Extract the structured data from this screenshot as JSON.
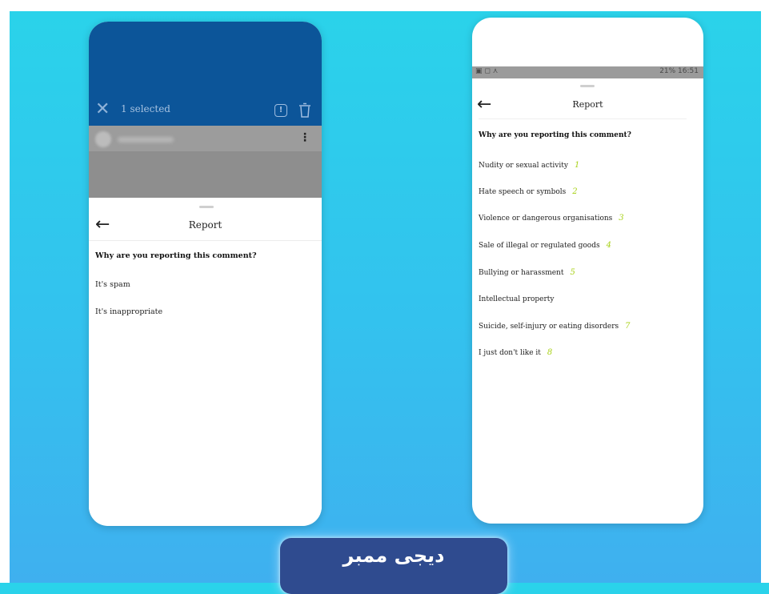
{
  "left_phone": {
    "action_bar": {
      "close_icon": "close-icon",
      "selected_text": "1 selected",
      "report_icon": "report-icon",
      "trash_icon": "trash-icon"
    },
    "sheet": {
      "back_icon": "arrow-left-icon",
      "title": "Report",
      "question": "Why are you reporting this comment?",
      "options": [
        "It's spam",
        "It's inappropriate"
      ]
    },
    "colors": {
      "header": "#0c5599",
      "overlay": "#8e8e8e"
    }
  },
  "right_phone": {
    "status_bar": {
      "left": "▣ ◻ ⋏",
      "right": "21% 16:51"
    },
    "sheet": {
      "back_icon": "arrow-left-icon",
      "title": "Report",
      "question": "Why are you reporting this comment?",
      "options": [
        {
          "label": "Nudity or sexual activity",
          "num": "1"
        },
        {
          "label": "Hate speech or symbols",
          "num": "2"
        },
        {
          "label": "Violence or dangerous organisations",
          "num": "3"
        },
        {
          "label": "Sale of illegal or regulated goods",
          "num": "4"
        },
        {
          "label": "Bullying or harassment",
          "num": "5"
        },
        {
          "label": "Intellectual property",
          "num": ""
        },
        {
          "label": "Suicide, self-injury or eating disorders",
          "num": "7"
        },
        {
          "label": "I just don't like it",
          "num": "8"
        }
      ]
    },
    "colors": {
      "number_accent": "#a9d21a"
    }
  },
  "logo": {
    "text": "دیجی ممبر",
    "color": "#2f4b8f"
  }
}
